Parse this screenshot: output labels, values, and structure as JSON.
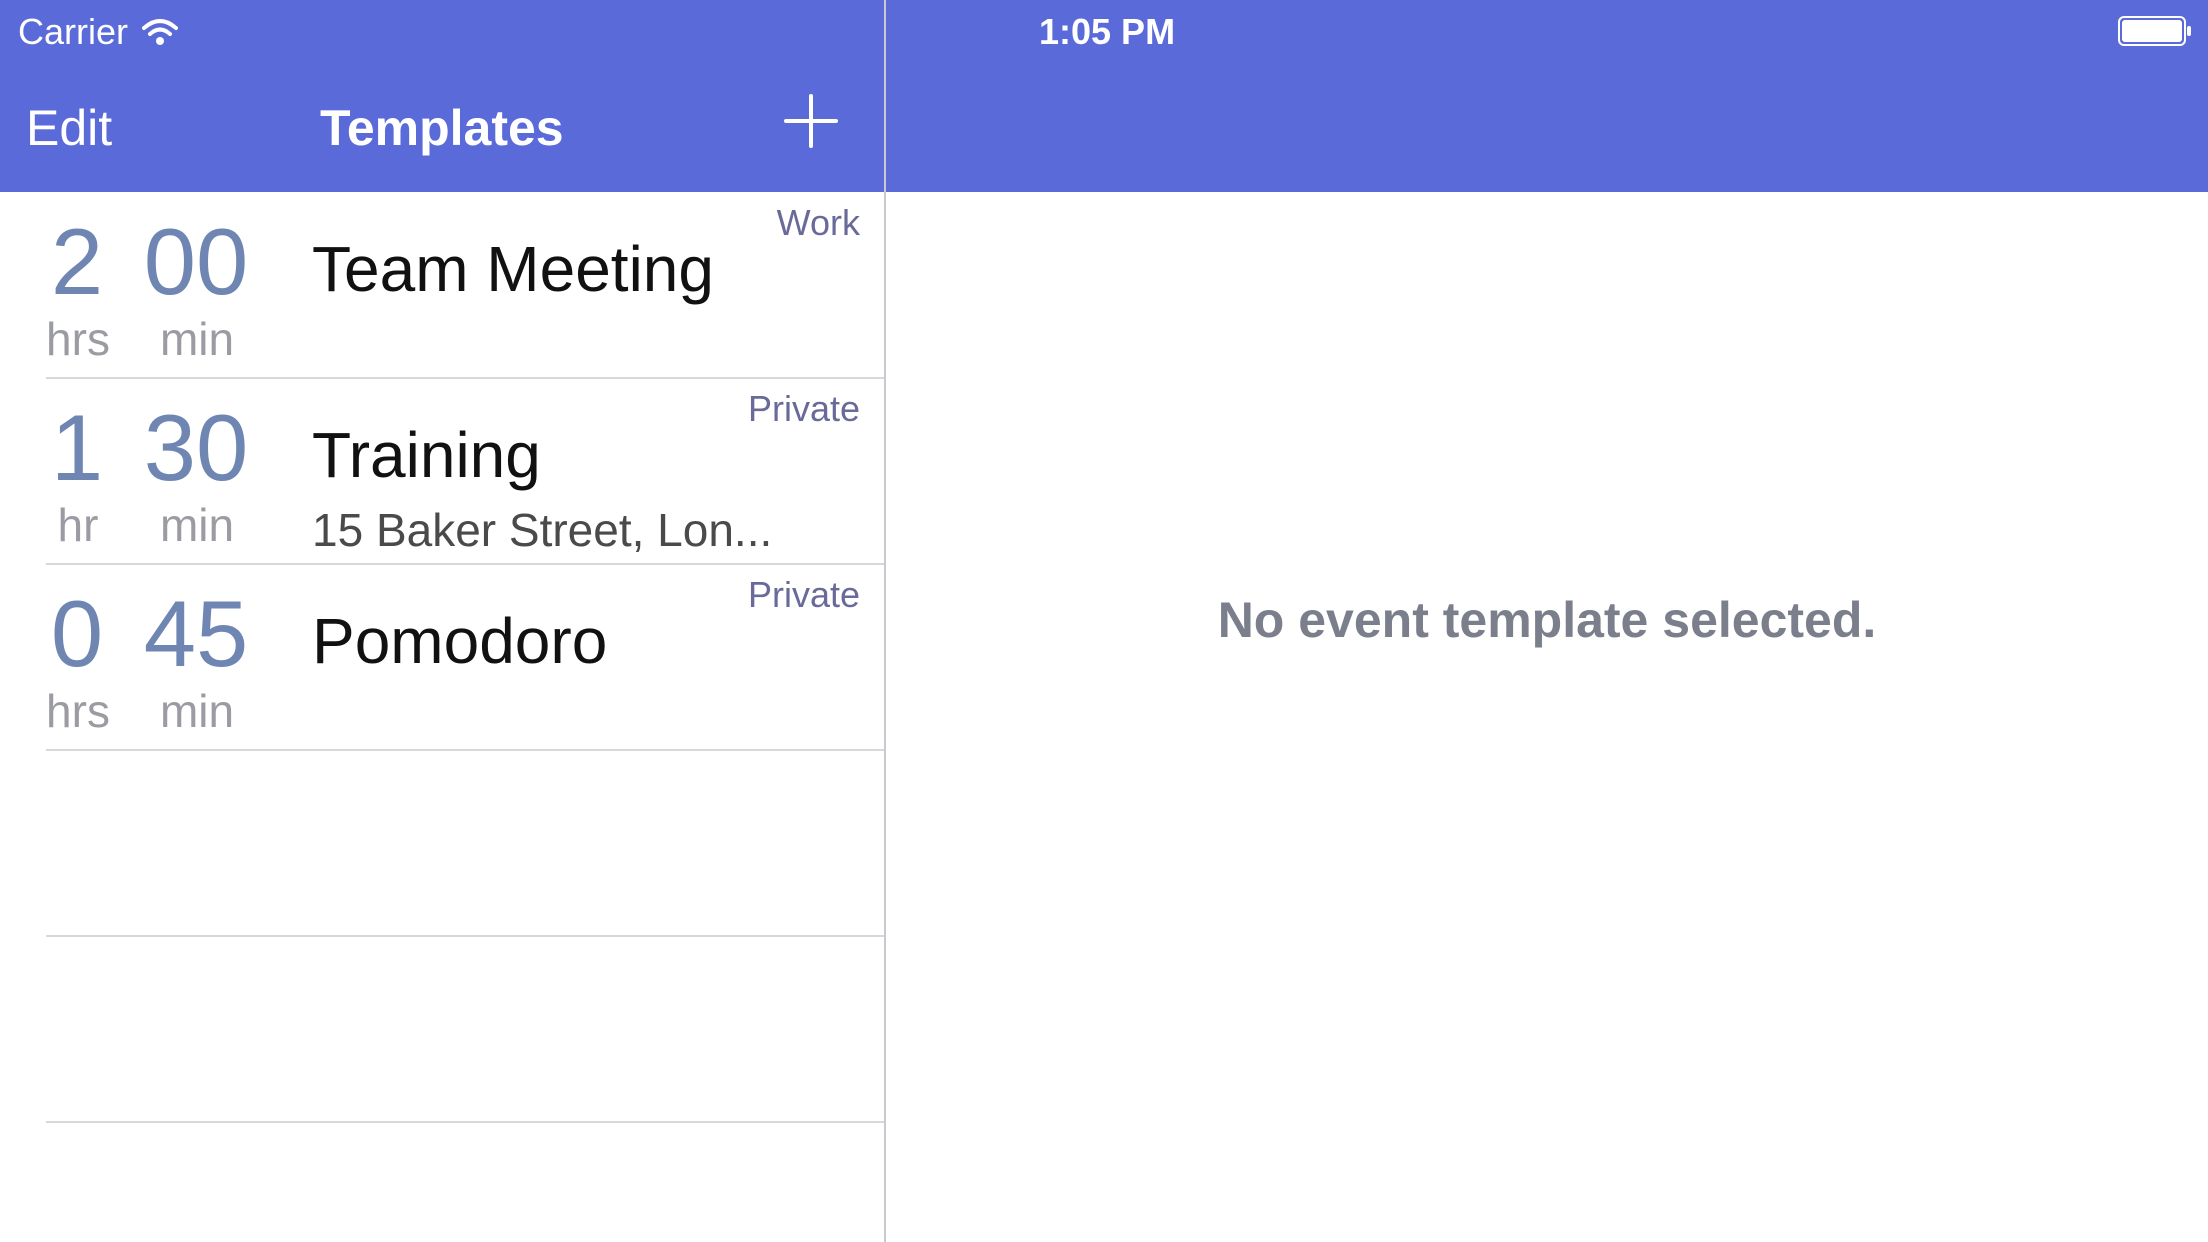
{
  "status_bar": {
    "carrier": "Carrier",
    "time": "1:05 PM"
  },
  "nav": {
    "edit_label": "Edit",
    "title": "Templates",
    "add_icon": "plus-icon"
  },
  "templates": [
    {
      "hours": "2",
      "hours_unit": "hrs",
      "minutes": "00",
      "minutes_unit": "min",
      "title": "Team Meeting",
      "location": "",
      "calendar": "Work"
    },
    {
      "hours": "1",
      "hours_unit": "hr",
      "minutes": "30",
      "minutes_unit": "min",
      "title": "Training",
      "location": "15 Baker Street, Lon...",
      "calendar": "Private"
    },
    {
      "hours": "0",
      "hours_unit": "hrs",
      "minutes": "45",
      "minutes_unit": "min",
      "title": "Pomodoro",
      "location": "",
      "calendar": "Private"
    }
  ],
  "detail": {
    "empty_message": "No event template selected."
  },
  "colors": {
    "nav_bar": "#5a6ad9",
    "duration_number": "#6f86b3",
    "calendar_label": "#6a6a9a"
  }
}
